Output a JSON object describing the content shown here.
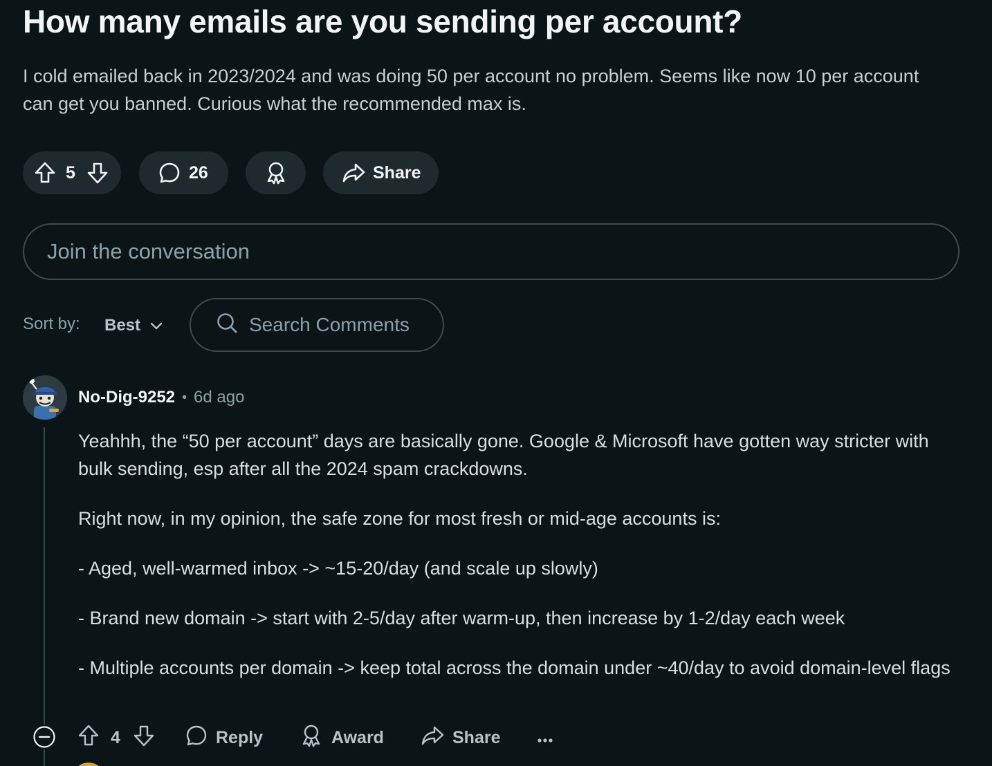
{
  "post": {
    "title": "How many emails are you sending per account?",
    "body": "I cold emailed back in 2023/2024 and was doing 50 per account no problem. Seems like now 10 per account can get you banned. Curious what the recommended max is.",
    "vote_count": "5",
    "comment_count": "26",
    "share_label": "Share"
  },
  "composer": {
    "placeholder": "Join the conversation"
  },
  "sort": {
    "label": "Sort by:",
    "value": "Best",
    "search_placeholder": "Search Comments"
  },
  "comment": {
    "author": "No-Dig-9252",
    "separator": "•",
    "time": "6d ago",
    "paragraphs": [
      "Yeahhh, the “50 per account” days are basically gone. Google & Microsoft have gotten way stricter with bulk sending, esp after all the 2024 spam crackdowns.",
      "Right now, in my opinion, the safe zone for most fresh or mid-age accounts is:",
      "- Aged, well-warmed inbox -> ~15-20/day (and scale up slowly)",
      "- Brand new domain -> start with 2-5/day after warm-up, then increase by 1-2/day each week",
      "- Multiple accounts per domain -> keep total across the domain under ~40/day to avoid domain-level flags"
    ],
    "vote_count": "4",
    "reply_label": "Reply",
    "award_label": "Award",
    "share_label": "Share"
  },
  "icons": {
    "upvote": "upvote-icon",
    "downvote": "downvote-icon",
    "comment": "comment-bubble-icon",
    "award": "award-icon",
    "share": "share-icon",
    "search": "search-icon",
    "chevron": "chevron-down-icon",
    "collapse": "collapse-icon",
    "more": "more-icon"
  },
  "colors": {
    "background": "#0b1416",
    "pill": "#1e2a2e",
    "muted_text": "#8ba2ad",
    "border": "#3e4c51"
  }
}
